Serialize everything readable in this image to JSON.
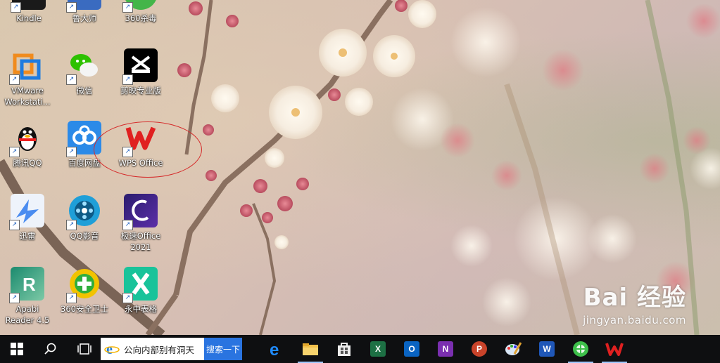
{
  "desktop": {
    "icons": [
      {
        "id": "kindle",
        "label": "Kindle"
      },
      {
        "id": "ludashi",
        "label": "鲁大师"
      },
      {
        "id": "360sha",
        "label": "360杀毒"
      },
      {
        "id": "vmware",
        "label": "VMware\nWorkstati..."
      },
      {
        "id": "wechat",
        "label": "微信"
      },
      {
        "id": "jianying",
        "label": "剪映专业版"
      },
      {
        "id": "qq",
        "label": "腾讯QQ"
      },
      {
        "id": "baidupan",
        "label": "百度网盘"
      },
      {
        "id": "wps",
        "label": "WPS Office"
      },
      {
        "id": "xunlei",
        "label": "迅雷"
      },
      {
        "id": "qqplayer",
        "label": "QQ影音"
      },
      {
        "id": "jisuoffice",
        "label": "极速Office\n2021"
      },
      {
        "id": "apabi",
        "label": "Apabi\nReader 4.5"
      },
      {
        "id": "360safe",
        "label": "360安全卫士"
      },
      {
        "id": "yozhong",
        "label": "永中表格"
      }
    ]
  },
  "watermark": {
    "logo": "Bai 经验",
    "url": "jingyan.baidu.com"
  },
  "taskbar": {
    "search_text": "公向内部别有洞天",
    "search_button": "搜索一下",
    "apps": [
      "Edge",
      "文件资源管理器",
      "Microsoft Store",
      "Excel",
      "Outlook",
      "OneNote",
      "PowerPoint",
      "画图",
      "Word",
      "360浏览器",
      "WPS Office"
    ]
  },
  "colors": {
    "taskbar": "#0e0f11",
    "search_button": "#2a74e0",
    "annotation": "#d52a2a"
  }
}
